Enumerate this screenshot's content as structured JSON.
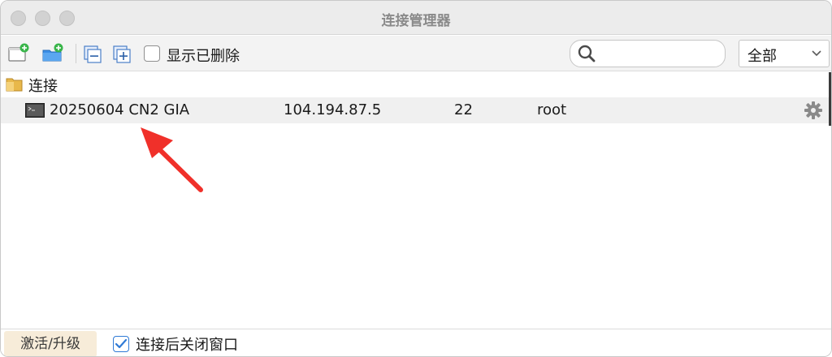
{
  "window": {
    "title": "连接管理器"
  },
  "toolbar": {
    "new_connection": "new-connection-icon",
    "new_folder": "new-folder-icon",
    "collapse": "collapse-all-icon",
    "expand": "expand-all-icon",
    "show_deleted_label": "显示已删除",
    "show_deleted_checked": false,
    "search_placeholder": "",
    "filter_selected": "全部"
  },
  "tree": {
    "group_label": "连接",
    "connections": [
      {
        "name": "20250604 CN2 GIA",
        "host": "104.194.87.5",
        "port": "22",
        "user": "root"
      }
    ]
  },
  "bottom": {
    "activate_label": "激活/升级",
    "close_after_connect_label": "连接后关闭窗口",
    "close_after_connect_checked": true
  },
  "colors": {
    "accent": "#2f7ad6",
    "arrow": "#f0302a",
    "row_bg": "#f0f0f0"
  }
}
